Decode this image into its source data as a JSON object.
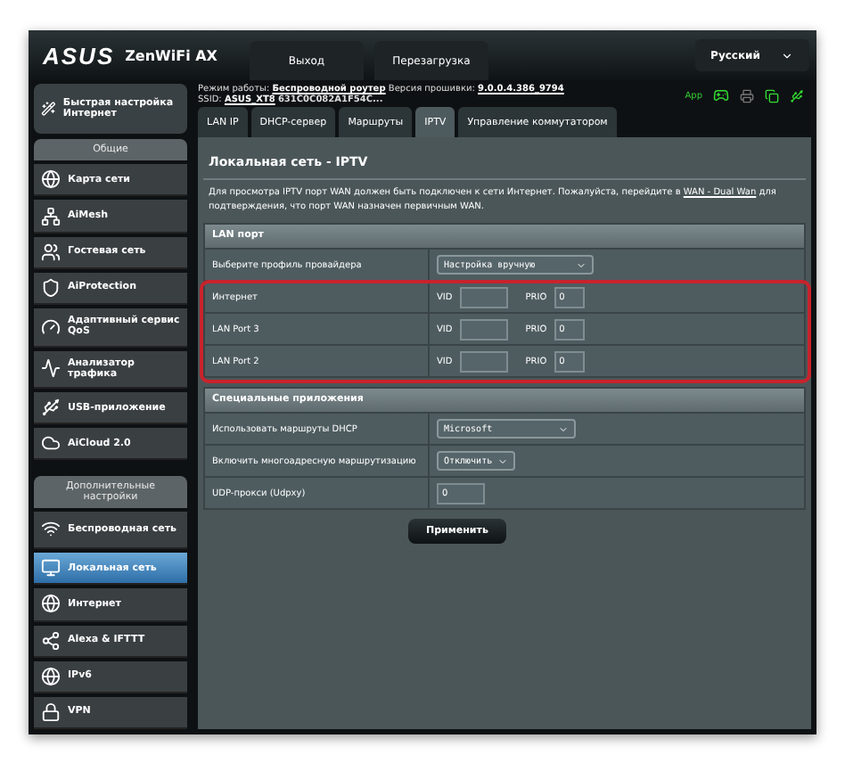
{
  "header": {
    "logo": "ASUS",
    "model": "ZenWiFi AX",
    "buttons": [
      "Выход",
      "Перезагрузка"
    ],
    "language": "Русский"
  },
  "sidebar": {
    "quick_setup": "Быстрая настройка Интернет",
    "sections": [
      {
        "title": "Общие",
        "items": [
          {
            "label": "Карта сети",
            "selected": false
          },
          {
            "label": "AiMesh",
            "selected": false
          },
          {
            "label": "Гостевая сеть",
            "selected": false
          },
          {
            "label": "AiProtection",
            "selected": false
          },
          {
            "label": "Адаптивный сервис QoS",
            "selected": false
          },
          {
            "label": "Анализатор трафика",
            "selected": false
          },
          {
            "label": "USB-приложение",
            "selected": false
          },
          {
            "label": "AiCloud 2.0",
            "selected": false
          }
        ]
      },
      {
        "title": "Дополнительные настройки",
        "items": [
          {
            "label": "Беспроводная сеть",
            "selected": false
          },
          {
            "label": "Локальная сеть",
            "selected": true
          },
          {
            "label": "Интернет",
            "selected": false
          },
          {
            "label": "Alexa & IFTTT",
            "selected": false
          },
          {
            "label": "IPv6",
            "selected": false
          },
          {
            "label": "VPN",
            "selected": false
          }
        ]
      }
    ]
  },
  "info": {
    "mode_label": "Режим работы:",
    "mode": "Беспроводной роутер",
    "firmware_label": "Версия прошивки:",
    "firmware": "9.0.0.4.386_9794",
    "ssid_label": "SSID:",
    "ssid": "ASUS_XT8",
    "ssid_2": "631C0C082A1F54C...",
    "app": "App"
  },
  "tabs": [
    {
      "label": "LAN IP",
      "selected": false
    },
    {
      "label": "DHCP-сервер",
      "selected": false
    },
    {
      "label": "Маршруты",
      "selected": false
    },
    {
      "label": "IPTV",
      "selected": true
    },
    {
      "label": "Управление коммутатором",
      "selected": false
    }
  ],
  "page_title": "Локальная сеть - IPTV",
  "description": {
    "before": "Для просмотра IPTV порт WAN должен быть подключен к сети Интернет. Пожалуйста, перейдите в ",
    "link": "WAN - Dual Wan",
    "after": " для подтверждения, что порт WAN назначен первичным WAN."
  },
  "lan_port": {
    "title": "LAN порт",
    "profile_label": "Выберите профиль провайдера",
    "profile": "Настройка вручную",
    "highlighted": true,
    "ports": [
      {
        "name": "Интернет",
        "vid_label": "VID",
        "prio_label": "PRIO",
        "prio": "0"
      },
      {
        "name": "LAN Port 3",
        "vid_label": "VID",
        "prio_label": "PRIO",
        "prio": "0"
      },
      {
        "name": "LAN Port 2",
        "vid_label": "VID",
        "prio_label": "PRIO",
        "prio": "0"
      }
    ]
  },
  "special": {
    "title": "Специальные приложения",
    "rows": [
      {
        "kind": "select",
        "label": "Использовать маршруты DHCP",
        "value": "Microsoft"
      },
      {
        "kind": "select",
        "label": "Включить многоадресную маршрутизацию",
        "value": "Отключить"
      },
      {
        "kind": "input",
        "label": "UDP-прокси (Udpxy)",
        "value": "0"
      }
    ]
  },
  "apply": "Применить"
}
